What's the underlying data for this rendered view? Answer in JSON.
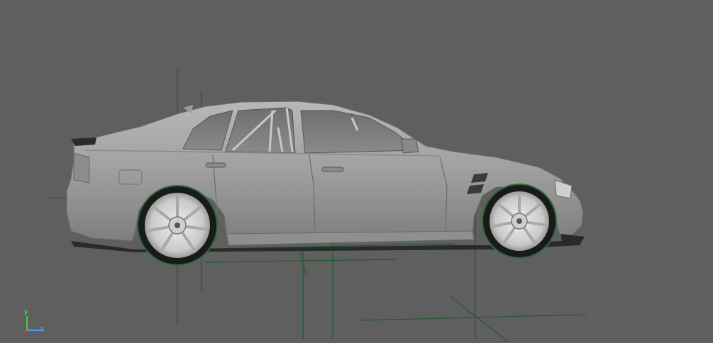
{
  "viewport": {
    "background_color": "#5f5f5f",
    "grid_line_color": "#1f5a2e",
    "camera_label": "",
    "model": {
      "description_icon": "car-mesh-icon",
      "body_color": "#9a9a9a",
      "wheel_color": "#d8d8d8",
      "tire_color": "#1a1a1a",
      "selection_outline_color": "#2e6b3a"
    },
    "axis_gizmo": {
      "y_label": "y",
      "z_label": "z",
      "y_color": "#3fd14a",
      "z_color": "#4aa0ff",
      "x_color": "#e04040"
    }
  }
}
